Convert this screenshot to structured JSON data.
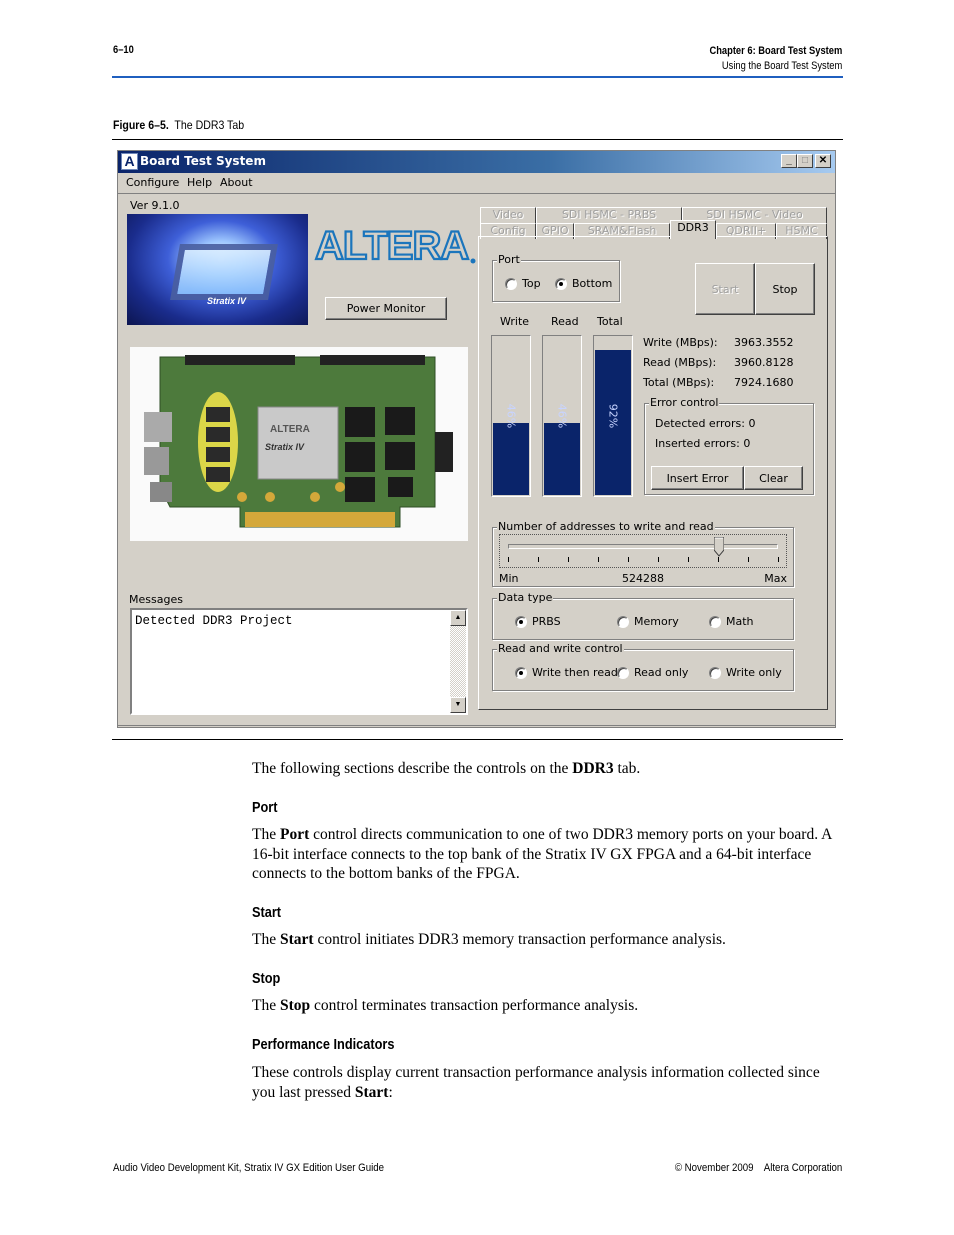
{
  "page_header": {
    "page_number": "6–10",
    "chapter": "Chapter 6:  Board Test System",
    "section": "Using the Board Test System"
  },
  "figure": {
    "label": "Figure 6–5.",
    "title": "The DDR3 Tab"
  },
  "window": {
    "title": "Board Test System",
    "logo_letter": "A",
    "controls": {
      "minimize": "_",
      "maximize": "□",
      "close": "✕"
    },
    "menu": [
      "Configure",
      "Help",
      "About"
    ],
    "version": "Ver 9.1.0",
    "chip_image_caption": "Stratix IV",
    "brand_logo": "ALTERA",
    "power_monitor_label": "Power Monitor",
    "board_image_caption": "ALTERA Stratix IV",
    "messages": {
      "label": "Messages",
      "text": "Detected DDR3 Project"
    },
    "tabs_row1": [
      "Video",
      "SDI HSMC - PRBS",
      "SDI HSMC - Video"
    ],
    "tabs_row2": [
      "Config",
      "GPIO",
      "SRAM&Flash",
      "DDR3",
      "QDRII+",
      "HSMC"
    ],
    "active_tab": "DDR3",
    "port": {
      "label": "Port",
      "options": [
        "Top",
        "Bottom"
      ],
      "selected": "Bottom"
    },
    "start_label": "Start",
    "stop_label": "Stop",
    "bars": [
      {
        "label": "Write",
        "percent": 46,
        "text": "46%"
      },
      {
        "label": "Read",
        "percent": 46,
        "text": "46%"
      },
      {
        "label": "Total",
        "percent": 92,
        "text": "92%"
      }
    ],
    "stats": [
      {
        "label": "Write (MBps):",
        "value": "3963.3552"
      },
      {
        "label": "Read (MBps):",
        "value": "3960.8128"
      },
      {
        "label": "Total (MBps):",
        "value": "7924.1680"
      }
    ],
    "error_control": {
      "label": "Error control",
      "detected": "Detected errors: 0",
      "inserted": "Inserted errors: 0",
      "insert_label": "Insert Error",
      "clear_label": "Clear"
    },
    "addresses": {
      "label": "Number of addresses to write and read",
      "min_label": "Min",
      "max_label": "Max",
      "value": "524288",
      "slider_position": 0.78
    },
    "data_type": {
      "label": "Data type",
      "options": [
        "PRBS",
        "Memory",
        "Math"
      ],
      "selected": "PRBS"
    },
    "rw_control": {
      "label": "Read and write control",
      "options": [
        "Write then read",
        "Read only",
        "Write only"
      ],
      "selected": "Write then read"
    }
  },
  "body": {
    "intro_pre": "The following sections describe the controls on the ",
    "intro_bold": "DDR3",
    "intro_post": " tab.",
    "sections": [
      {
        "heading": "Port",
        "pre": "The ",
        "bold": "Port",
        "post": " control directs communication to one of two DDR3 memory ports on your board. A 16-bit interface connects to the top bank of the Stratix IV GX FPGA and a 64-bit interface connects to the bottom banks of the FPGA."
      },
      {
        "heading": "Start",
        "pre": "The ",
        "bold": "Start",
        "post": " control initiates DDR3 memory transaction performance analysis."
      },
      {
        "heading": "Stop",
        "pre": "The ",
        "bold": "Stop",
        "post": " control terminates transaction performance analysis."
      },
      {
        "heading": "Performance Indicators",
        "pre": "These controls display current transaction performance analysis information collected since you last pressed ",
        "bold": "Start",
        "post": ":"
      }
    ]
  },
  "footer": {
    "left": "Audio Video Development Kit, Stratix IV GX Edition User Guide",
    "right": "© November 2009    Altera Corporation"
  }
}
